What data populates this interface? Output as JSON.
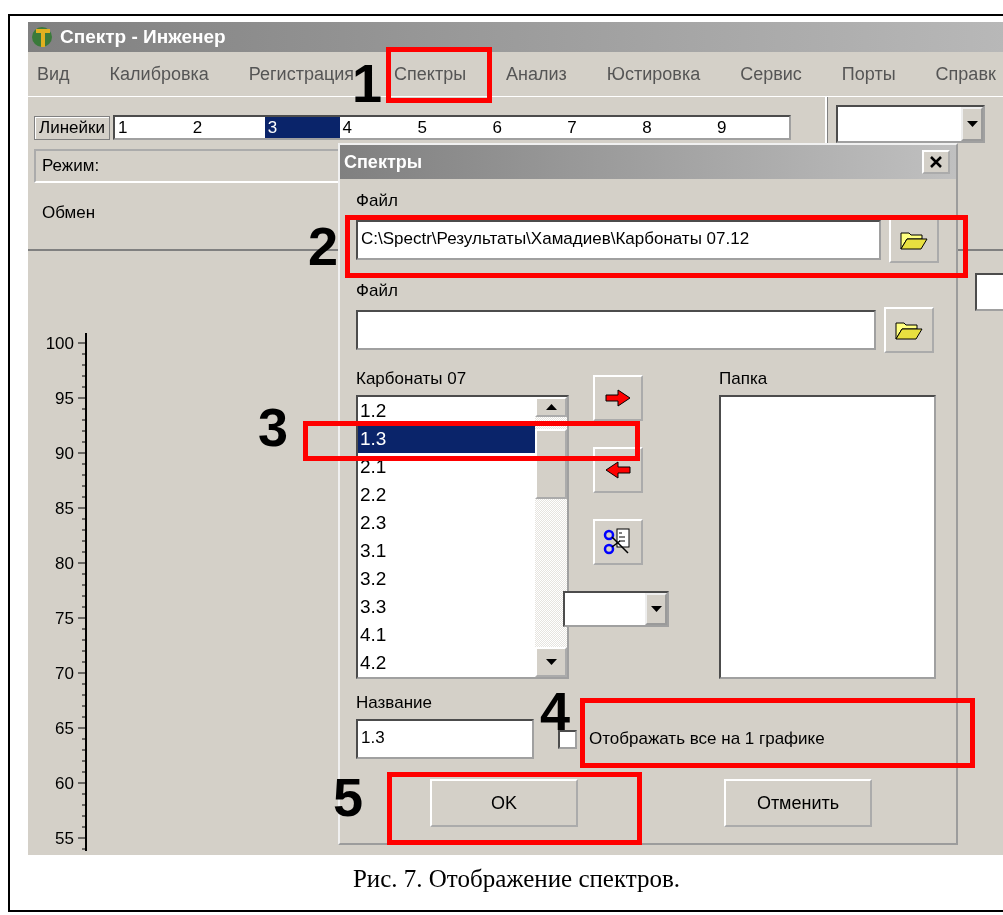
{
  "window": {
    "title": "Спектр - Инженер"
  },
  "menu": [
    "Вид",
    "Калибровка",
    "Регистрация",
    "Спектры",
    "Анализ",
    "Юстировка",
    "Сервис",
    "Порты",
    "Справк"
  ],
  "lines": {
    "label": "Линейки",
    "items": [
      {
        "text": "1",
        "selected": false
      },
      {
        "text": "2",
        "selected": false
      },
      {
        "text": "3",
        "selected": true
      },
      {
        "text": "4",
        "selected": false
      },
      {
        "text": "5",
        "selected": false
      },
      {
        "text": "6",
        "selected": false
      },
      {
        "text": "7",
        "selected": false
      },
      {
        "text": "8",
        "selected": false
      },
      {
        "text": "9",
        "selected": false
      }
    ]
  },
  "mode_label": "Режим:",
  "exchange_label": "Обмен",
  "axis_labels": [
    "100",
    "95",
    "90",
    "85",
    "80",
    "75",
    "70",
    "65",
    "60",
    "55"
  ],
  "dialog": {
    "title": "Спектры",
    "file_1": {
      "label": "Файл",
      "value": "C:\\Spectr\\Результаты\\Хамадиев\\Карбонаты 07.12"
    },
    "file_2": {
      "label": "Файл"
    },
    "list": {
      "label": "Карбонаты 07",
      "items": [
        {
          "text": "1.2",
          "selected": false
        },
        {
          "text": "1.3",
          "selected": true
        },
        {
          "text": "2.1",
          "selected": false
        },
        {
          "text": "2.2",
          "selected": false
        },
        {
          "text": "2.3",
          "selected": false
        },
        {
          "text": "3.1",
          "selected": false
        },
        {
          "text": "3.2",
          "selected": false
        },
        {
          "text": "3.3",
          "selected": false
        },
        {
          "text": "4.1",
          "selected": false
        },
        {
          "text": "4.2",
          "selected": false
        }
      ]
    },
    "folder_label": "Папка",
    "name": {
      "label": "Название",
      "value": "1.3"
    },
    "show_all": {
      "label": "Отображать все на 1 графике",
      "checked": false
    },
    "buttons": [
      "OK",
      "Отменить"
    ]
  },
  "annotations": [
    {
      "number": "1"
    },
    {
      "number": "2"
    },
    {
      "number": "3"
    },
    {
      "number": "4"
    },
    {
      "number": "5"
    }
  ],
  "caption": "Рис. 7. Отображение спектров."
}
